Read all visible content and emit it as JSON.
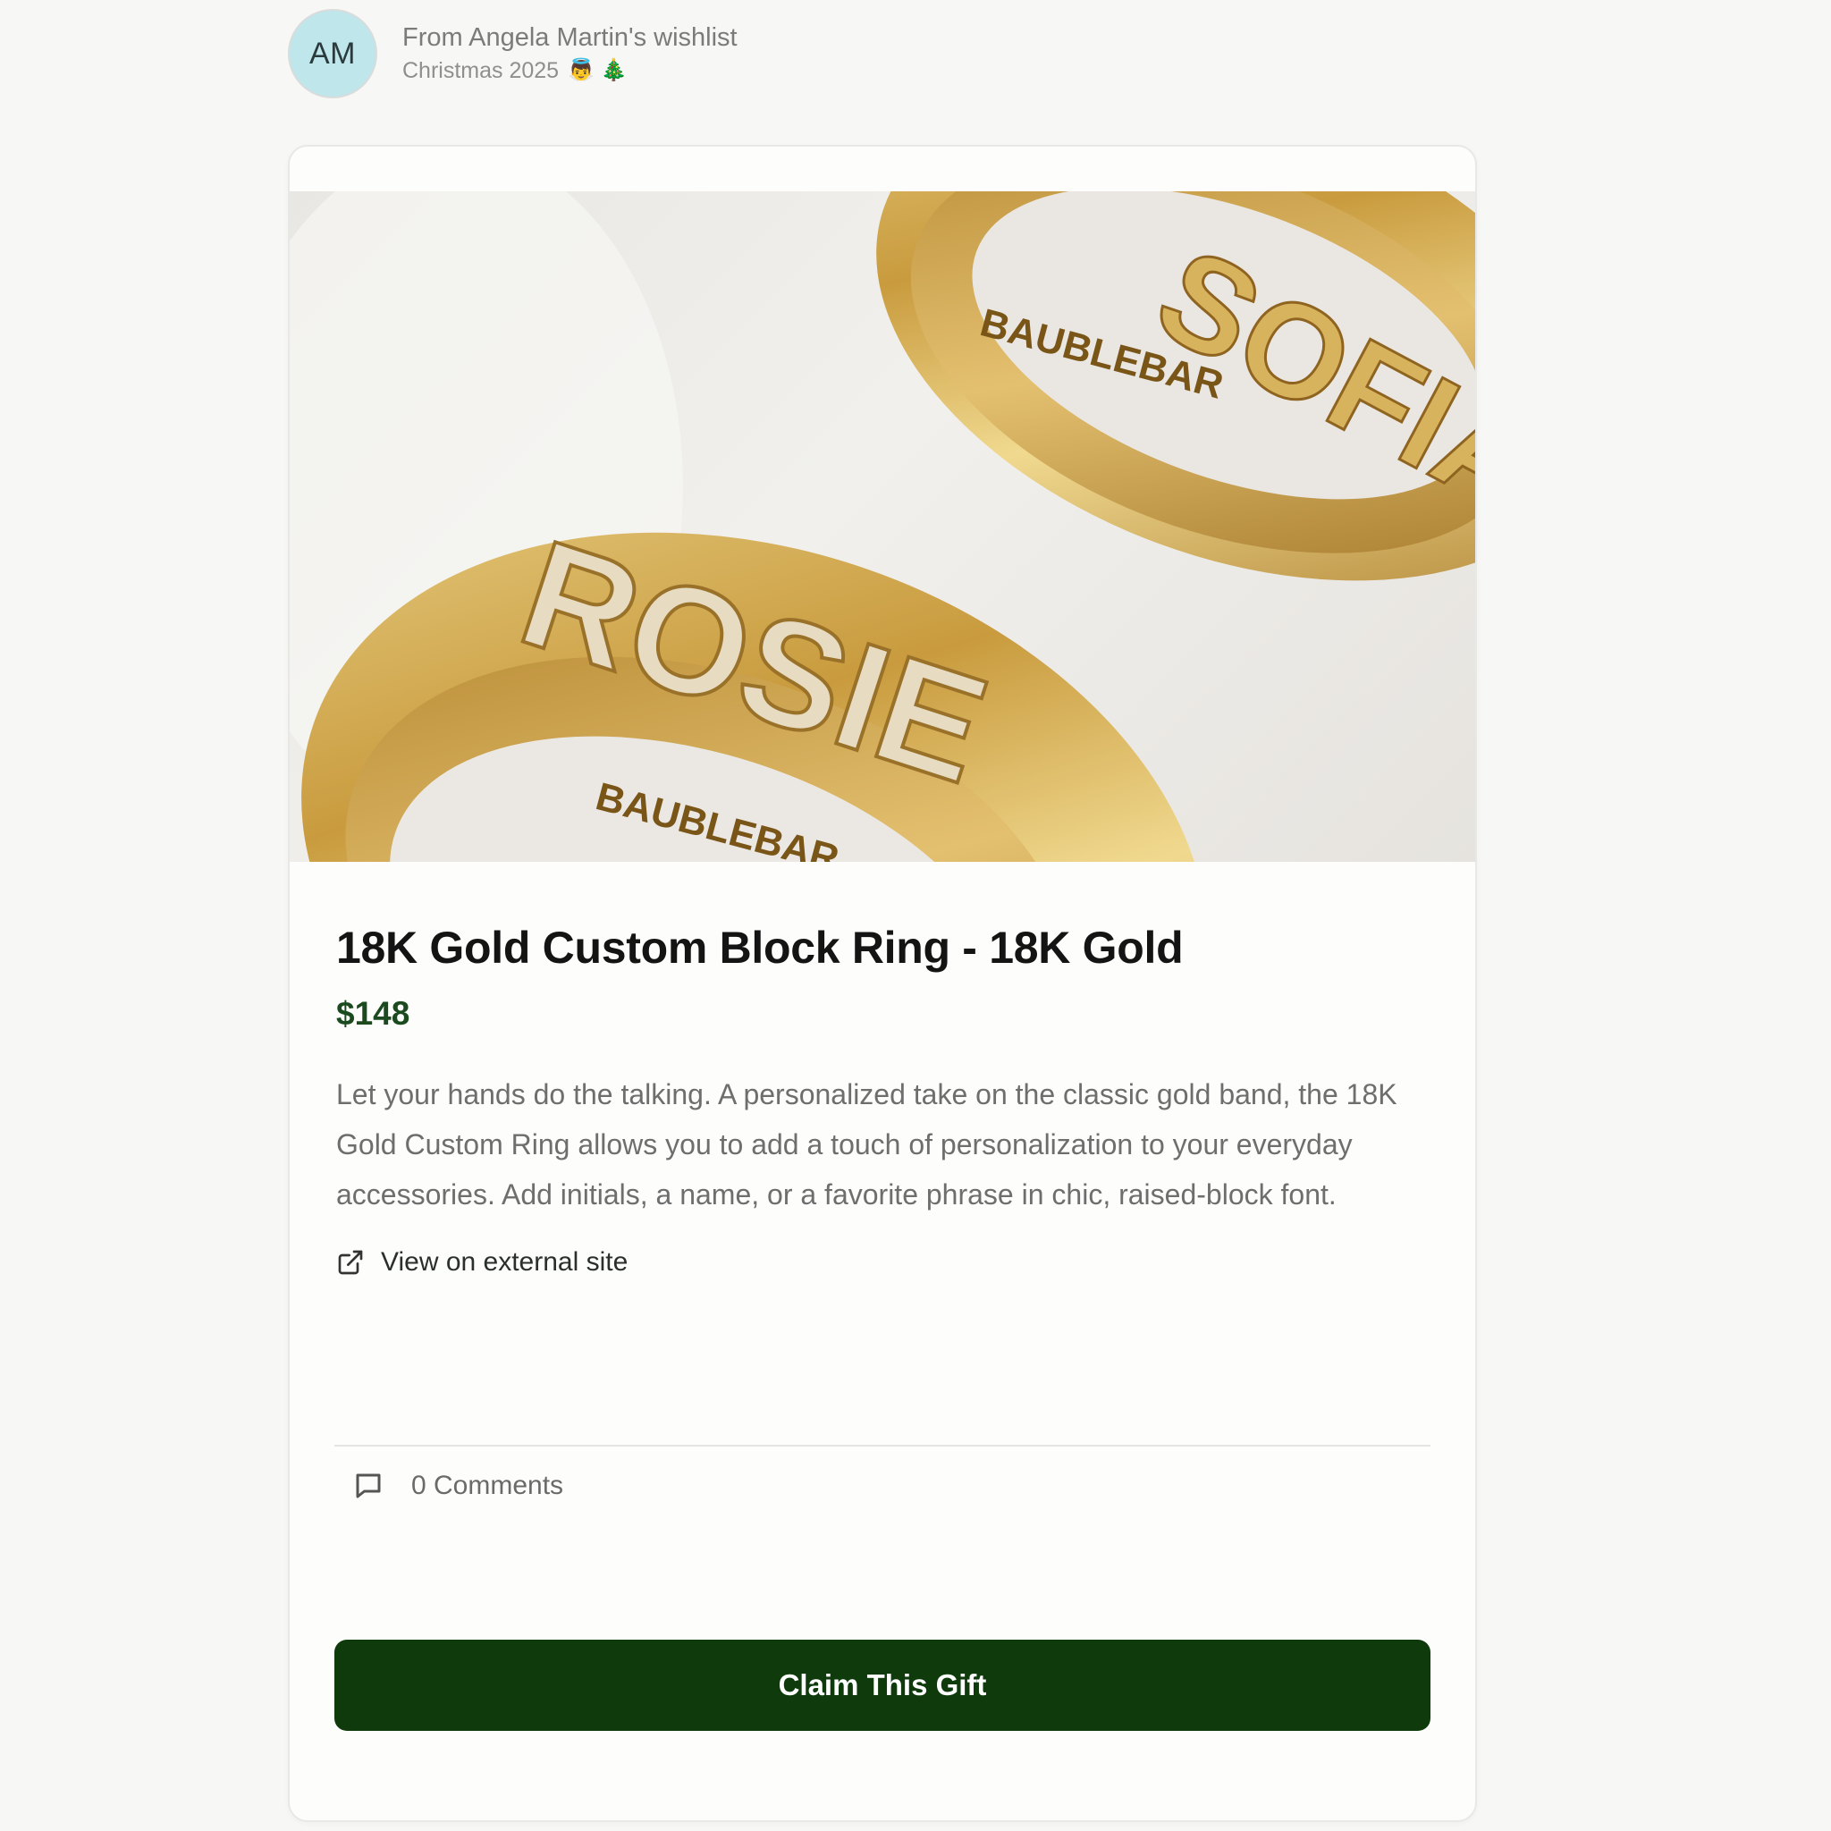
{
  "header": {
    "avatar_initials": "AM",
    "title": "From Angela Martin's wishlist",
    "subtitle": "Christmas 2025",
    "subtitle_emojis": "👼 🎄"
  },
  "product": {
    "image_alt": "Two 18K gold custom block rings engraved BAUBLEBAR",
    "ring_text_top": "SOFIA",
    "ring_text_bottom": "ROSIE",
    "engraving": "BAUBLEBAR",
    "title": "18K Gold Custom Block Ring - 18K Gold",
    "price": "$148",
    "description": "Let your hands do the talking. A personalized take on the classic gold band, the 18K Gold Custom Ring allows you to add a touch of personalization to your everyday accessories. Add initials, a name, or a favorite phrase in chic, raised-block font.",
    "external_link_label": "View on external site",
    "external_link_icon": "external-link-icon"
  },
  "comments": {
    "label": "0 Comments",
    "icon": "comment-icon"
  },
  "actions": {
    "claim_label": "Claim This Gift"
  },
  "colors": {
    "accent_green": "#0f3a0c",
    "price_green": "#1c4a1f",
    "avatar_bg": "#bfe6ea",
    "gold": "#c9a24a"
  }
}
